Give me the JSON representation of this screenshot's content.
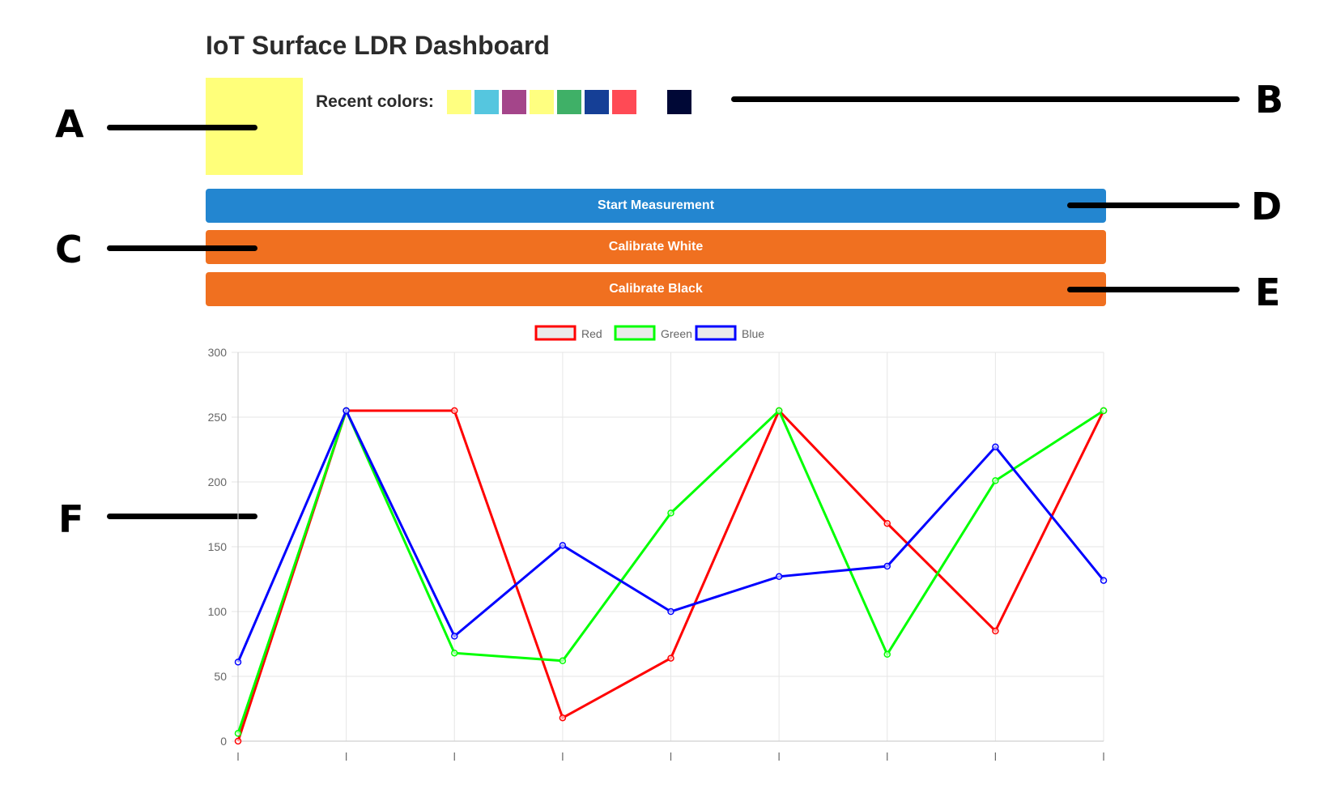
{
  "page": {
    "title": "IoT Surface LDR Dashboard"
  },
  "current_color": "#ffff7a",
  "recent_colors": {
    "label": "Recent colors:",
    "swatches": [
      "#ffff80",
      "#55c6df",
      "#a4458a",
      "#ffff80",
      "#3fb067",
      "#153f96",
      "#ff4a55",
      "#ffffff",
      "#000836"
    ]
  },
  "buttons": {
    "start_measurement": {
      "label": "Start Measurement",
      "color": "#2386d0"
    },
    "calibrate_white": {
      "label": "Calibrate White",
      "color": "#f07020"
    },
    "calibrate_black": {
      "label": "Calibrate Black",
      "color": "#f07020"
    }
  },
  "annotations": [
    "A",
    "B",
    "C",
    "D",
    "E",
    "F"
  ],
  "chart_data": {
    "type": "line",
    "x": [
      "",
      "",
      "",
      "",
      "",
      "",
      "",
      "",
      ""
    ],
    "ylim": [
      0,
      300
    ],
    "yticks": [
      0,
      50,
      100,
      150,
      200,
      250,
      300
    ],
    "grid": true,
    "legend": "top-center",
    "series": [
      {
        "name": "Red",
        "color": "#ff0000",
        "values": [
          0,
          255,
          255,
          18,
          64,
          255,
          168,
          85,
          255
        ]
      },
      {
        "name": "Green",
        "color": "#00ff00",
        "values": [
          6,
          255,
          68,
          62,
          176,
          255,
          67,
          201,
          255
        ]
      },
      {
        "name": "Blue",
        "color": "#0000ff",
        "values": [
          61,
          255,
          81,
          151,
          100,
          127,
          135,
          227,
          124
        ]
      }
    ]
  }
}
